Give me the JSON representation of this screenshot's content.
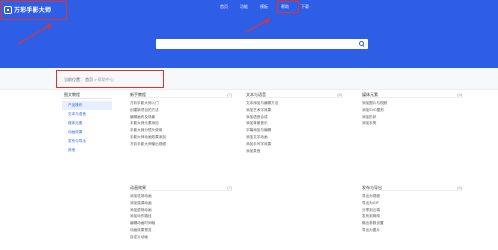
{
  "logo": {
    "text": "万彩手影大师",
    "icon": "logo-square-icon"
  },
  "nav": [
    {
      "label": "首页"
    },
    {
      "label": "功能"
    },
    {
      "label": "模板"
    },
    {
      "label": "帮助",
      "caret": "▾"
    },
    {
      "label": "下载"
    }
  ],
  "search": {
    "placeholder": "",
    "icon": "search-icon"
  },
  "breadcrumb": {
    "prefix": "当前位置：",
    "home": "首页",
    "sep": ">",
    "current": "帮助中心"
  },
  "sidebar": {
    "title": "图文教程",
    "items": [
      {
        "label": "产品操作"
      },
      {
        "label": "文本与语音"
      },
      {
        "label": "媒体元素"
      },
      {
        "label": "动画效果"
      },
      {
        "label": "发布与导出"
      },
      {
        "label": "其他"
      }
    ]
  },
  "sections": {
    "s1": {
      "title": "新手教程",
      "count": "(7)",
      "items": [
        "万彩手影大师入门",
        "创建新项目的方法",
        "编辑画布及场景",
        "手影大师元素添加",
        "手影大师分镜头使用",
        "手影大师动画效果添加",
        "万彩手影大师输出视频"
      ]
    },
    "s2": {
      "title": "文本与语音",
      "count": "(8)",
      "items": [
        "文本添加与编辑方法",
        "添加艺术字效果",
        "添加语音合成",
        "添加背景音乐",
        "字幕添加与编辑",
        "添加文字动画",
        "添加手写字效果",
        "添加录音"
      ]
    },
    "s3": {
      "title": "媒体元素",
      "count": "(4)",
      "items": [
        "添加图片与视频",
        "添加SVG图形",
        "添加形状",
        "添加手势"
      ]
    },
    "s4": {
      "title": "动画效果",
      "count": "(7)",
      "items": [
        "添加进场动画",
        "添加强调动画",
        "添加退场动画",
        "添加动作路径",
        "编辑动画时间轴",
        "动画效果预览",
        "自定义动画"
      ]
    },
    "s5": {
      "title": "发布与导出",
      "count": "(6)",
      "items": [
        "导出为视频",
        "导出为GIF",
        "分享到云端",
        "发布到网络",
        "输出参数设置",
        "导出为图片"
      ]
    }
  },
  "colors": {
    "brand": "#2f5ee6",
    "annotation": "#e0332e"
  }
}
